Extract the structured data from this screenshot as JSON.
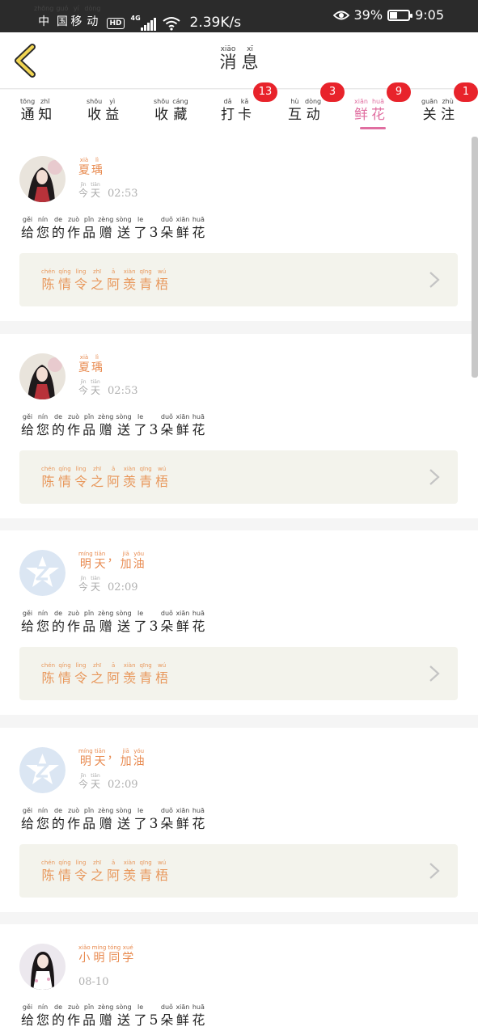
{
  "status_bar": {
    "carrier": [
      {
        "py": "zhōng",
        "hz": "中"
      },
      {
        "py": "guó",
        "hz": "国"
      },
      {
        "py": "yí",
        "hz": "移"
      },
      {
        "py": "dòng",
        "hz": "动"
      }
    ],
    "hd": "HD",
    "network": "4G",
    "speed": "2.39K/s",
    "battery_pct": "39%",
    "battery_level": 0.39,
    "time": "9:05"
  },
  "header": {
    "title": [
      {
        "py": "xiāo",
        "hz": "消"
      },
      {
        "py": "xī",
        "hz": "息"
      }
    ],
    "back_icon": "chevron-left-icon",
    "back_color": "#f1d552"
  },
  "tabs": [
    {
      "id": "notice",
      "chars": [
        {
          "py": "tōng",
          "hz": "通"
        },
        {
          "py": "zhī",
          "hz": "知"
        }
      ],
      "badge": ""
    },
    {
      "id": "income",
      "chars": [
        {
          "py": "shōu",
          "hz": "收"
        },
        {
          "py": "yì",
          "hz": "益"
        }
      ],
      "badge": ""
    },
    {
      "id": "favorite",
      "chars": [
        {
          "py": "shōu",
          "hz": "收"
        },
        {
          "py": "cáng",
          "hz": "藏"
        }
      ],
      "badge": ""
    },
    {
      "id": "checkin",
      "chars": [
        {
          "py": "dǎ",
          "hz": "打"
        },
        {
          "py": "kǎ",
          "hz": "卡"
        }
      ],
      "badge": "13"
    },
    {
      "id": "interact",
      "chars": [
        {
          "py": "hù",
          "hz": "互"
        },
        {
          "py": "dòng",
          "hz": "动"
        }
      ],
      "badge": "3"
    },
    {
      "id": "flowers",
      "chars": [
        {
          "py": "xiān",
          "hz": "鲜"
        },
        {
          "py": "huā",
          "hz": "花"
        }
      ],
      "badge": "9",
      "active": true
    },
    {
      "id": "follow",
      "chars": [
        {
          "py": "guān",
          "hz": "关"
        },
        {
          "py": "zhù",
          "hz": "注"
        }
      ],
      "badge": "1"
    }
  ],
  "colors": {
    "accent_pink": "#e06ea0",
    "badge_red": "#e8232b",
    "name_orange": "#e88a4f",
    "work_bg": "#f3f3ec"
  },
  "messages": [
    {
      "avatar": "girl-portrait-avatar",
      "user": [
        {
          "py": "xià",
          "hz": "夏"
        },
        {
          "py": "lì",
          "hz": "瑀"
        }
      ],
      "day": [
        {
          "py": "jīn",
          "hz": "今"
        },
        {
          "py": "tiān",
          "hz": "天"
        }
      ],
      "time": "02:53",
      "text": [
        {
          "py": "gěi",
          "hz": "给"
        },
        {
          "py": "nín",
          "hz": "您"
        },
        {
          "py": "de",
          "hz": "的"
        },
        {
          "py": "zuò",
          "hz": "作"
        },
        {
          "py": "pǐn",
          "hz": "品"
        },
        {
          "py": "zèng",
          "hz": "赠"
        },
        {
          "py": "sòng",
          "hz": "送"
        },
        {
          "py": "le",
          "hz": "了"
        }
      ],
      "count": "3",
      "unit": [
        {
          "py": "duǒ",
          "hz": "朵"
        },
        {
          "py": "xiān",
          "hz": "鲜"
        },
        {
          "py": "huā",
          "hz": "花"
        }
      ],
      "work": [
        {
          "py": "chén",
          "hz": "陈"
        },
        {
          "py": "qíng",
          "hz": "情"
        },
        {
          "py": "lìng",
          "hz": "令"
        },
        {
          "py": "zhī",
          "hz": "之"
        },
        {
          "py": "ā",
          "hz": "阿"
        },
        {
          "py": "xiàn",
          "hz": "羡"
        },
        {
          "py": "qīng",
          "hz": "青"
        },
        {
          "py": "wú",
          "hz": "梧"
        }
      ]
    },
    {
      "avatar": "girl-portrait-avatar",
      "user": [
        {
          "py": "xià",
          "hz": "夏"
        },
        {
          "py": "lì",
          "hz": "瑀"
        }
      ],
      "day": [
        {
          "py": "jīn",
          "hz": "今"
        },
        {
          "py": "tiān",
          "hz": "天"
        }
      ],
      "time": "02:53",
      "text": [
        {
          "py": "gěi",
          "hz": "给"
        },
        {
          "py": "nín",
          "hz": "您"
        },
        {
          "py": "de",
          "hz": "的"
        },
        {
          "py": "zuò",
          "hz": "作"
        },
        {
          "py": "pǐn",
          "hz": "品"
        },
        {
          "py": "zèng",
          "hz": "赠"
        },
        {
          "py": "sòng",
          "hz": "送"
        },
        {
          "py": "le",
          "hz": "了"
        }
      ],
      "count": "3",
      "unit": [
        {
          "py": "duǒ",
          "hz": "朵"
        },
        {
          "py": "xiān",
          "hz": "鲜"
        },
        {
          "py": "huā",
          "hz": "花"
        }
      ],
      "work": [
        {
          "py": "chén",
          "hz": "陈"
        },
        {
          "py": "qíng",
          "hz": "情"
        },
        {
          "py": "lìng",
          "hz": "令"
        },
        {
          "py": "zhī",
          "hz": "之"
        },
        {
          "py": "ā",
          "hz": "阿"
        },
        {
          "py": "xiàn",
          "hz": "羡"
        },
        {
          "py": "qīng",
          "hz": "青"
        },
        {
          "py": "wú",
          "hz": "梧"
        }
      ]
    },
    {
      "avatar": "default-star-avatar",
      "user": [
        {
          "py": "míng",
          "hz": "明"
        },
        {
          "py": "tiān",
          "hz": "天"
        },
        {
          "py": "",
          "hz": "，"
        },
        {
          "py": "jiā",
          "hz": "加"
        },
        {
          "py": "yóu",
          "hz": "油"
        }
      ],
      "day": [
        {
          "py": "jīn",
          "hz": "今"
        },
        {
          "py": "tiān",
          "hz": "天"
        }
      ],
      "time": "02:09",
      "text": [
        {
          "py": "gěi",
          "hz": "给"
        },
        {
          "py": "nín",
          "hz": "您"
        },
        {
          "py": "de",
          "hz": "的"
        },
        {
          "py": "zuò",
          "hz": "作"
        },
        {
          "py": "pǐn",
          "hz": "品"
        },
        {
          "py": "zèng",
          "hz": "赠"
        },
        {
          "py": "sòng",
          "hz": "送"
        },
        {
          "py": "le",
          "hz": "了"
        }
      ],
      "count": "3",
      "unit": [
        {
          "py": "duǒ",
          "hz": "朵"
        },
        {
          "py": "xiān",
          "hz": "鲜"
        },
        {
          "py": "huā",
          "hz": "花"
        }
      ],
      "work": [
        {
          "py": "chén",
          "hz": "陈"
        },
        {
          "py": "qíng",
          "hz": "情"
        },
        {
          "py": "lìng",
          "hz": "令"
        },
        {
          "py": "zhī",
          "hz": "之"
        },
        {
          "py": "ā",
          "hz": "阿"
        },
        {
          "py": "xiàn",
          "hz": "羡"
        },
        {
          "py": "qīng",
          "hz": "青"
        },
        {
          "py": "wú",
          "hz": "梧"
        }
      ]
    },
    {
      "avatar": "default-star-avatar",
      "user": [
        {
          "py": "míng",
          "hz": "明"
        },
        {
          "py": "tiān",
          "hz": "天"
        },
        {
          "py": "",
          "hz": "，"
        },
        {
          "py": "jiā",
          "hz": "加"
        },
        {
          "py": "yóu",
          "hz": "油"
        }
      ],
      "day": [
        {
          "py": "jīn",
          "hz": "今"
        },
        {
          "py": "tiān",
          "hz": "天"
        }
      ],
      "time": "02:09",
      "text": [
        {
          "py": "gěi",
          "hz": "给"
        },
        {
          "py": "nín",
          "hz": "您"
        },
        {
          "py": "de",
          "hz": "的"
        },
        {
          "py": "zuò",
          "hz": "作"
        },
        {
          "py": "pǐn",
          "hz": "品"
        },
        {
          "py": "zèng",
          "hz": "赠"
        },
        {
          "py": "sòng",
          "hz": "送"
        },
        {
          "py": "le",
          "hz": "了"
        }
      ],
      "count": "3",
      "unit": [
        {
          "py": "duǒ",
          "hz": "朵"
        },
        {
          "py": "xiān",
          "hz": "鲜"
        },
        {
          "py": "huā",
          "hz": "花"
        }
      ],
      "work": [
        {
          "py": "chén",
          "hz": "陈"
        },
        {
          "py": "qíng",
          "hz": "情"
        },
        {
          "py": "lìng",
          "hz": "令"
        },
        {
          "py": "zhī",
          "hz": "之"
        },
        {
          "py": "ā",
          "hz": "阿"
        },
        {
          "py": "xiàn",
          "hz": "羡"
        },
        {
          "py": "qīng",
          "hz": "青"
        },
        {
          "py": "wú",
          "hz": "梧"
        }
      ]
    },
    {
      "avatar": "girl-white-dress-avatar",
      "user": [
        {
          "py": "xiǎo",
          "hz": "小"
        },
        {
          "py": "míng",
          "hz": "明"
        },
        {
          "py": "tóng",
          "hz": "同"
        },
        {
          "py": "xué",
          "hz": "学"
        }
      ],
      "date": "08-10",
      "text": [
        {
          "py": "gěi",
          "hz": "给"
        },
        {
          "py": "nín",
          "hz": "您"
        },
        {
          "py": "de",
          "hz": "的"
        },
        {
          "py": "zuò",
          "hz": "作"
        },
        {
          "py": "pǐn",
          "hz": "品"
        },
        {
          "py": "zèng",
          "hz": "赠"
        },
        {
          "py": "sòng",
          "hz": "送"
        },
        {
          "py": "le",
          "hz": "了"
        }
      ],
      "count": "5",
      "unit": [
        {
          "py": "duǒ",
          "hz": "朵"
        },
        {
          "py": "xiān",
          "hz": "鲜"
        },
        {
          "py": "huā",
          "hz": "花"
        }
      ]
    }
  ]
}
